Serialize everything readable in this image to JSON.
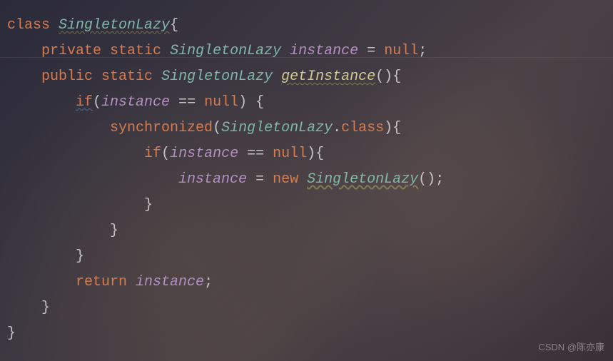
{
  "code": {
    "line1": {
      "kw_class": "class",
      "type": "SingletonLazy",
      "brace": "{"
    },
    "line2": {
      "kw_private": "private",
      "kw_static": "static",
      "type": "SingletonLazy",
      "field": "instance",
      "op": "=",
      "null": "null",
      "semi": ";"
    },
    "line3": {
      "kw_public": "public",
      "kw_static": "static",
      "type": "SingletonLazy",
      "method": "getInstance",
      "parens": "()",
      "brace": "{"
    },
    "line4": {
      "kw_if": "if",
      "lparen": "(",
      "field": "instance",
      "op": "==",
      "null": "null",
      "rparen": ")",
      "brace": "{"
    },
    "line5": {
      "kw_sync": "synchronized",
      "lparen": "(",
      "type": "SingletonLazy",
      "dot": ".",
      "kw_class": "class",
      "rparen": ")",
      "brace": "{"
    },
    "line6": {
      "kw_if": "if",
      "lparen": "(",
      "field": "instance",
      "op": "==",
      "null": "null",
      "rparen": ")",
      "brace": "{"
    },
    "line7": {
      "field": "instance",
      "op": "=",
      "kw_new": "new",
      "ctor": "SingletonLazy",
      "parens": "()",
      "semi": ";"
    },
    "line8": {
      "brace": "}"
    },
    "line9": {
      "brace": "}"
    },
    "line10": {
      "brace": "}"
    },
    "line11": {
      "kw_return": "return",
      "field": "instance",
      "semi": ";"
    },
    "line12": {
      "brace": "}"
    },
    "line13": {
      "brace": "}"
    }
  },
  "watermark": "CSDN @陈亦康"
}
